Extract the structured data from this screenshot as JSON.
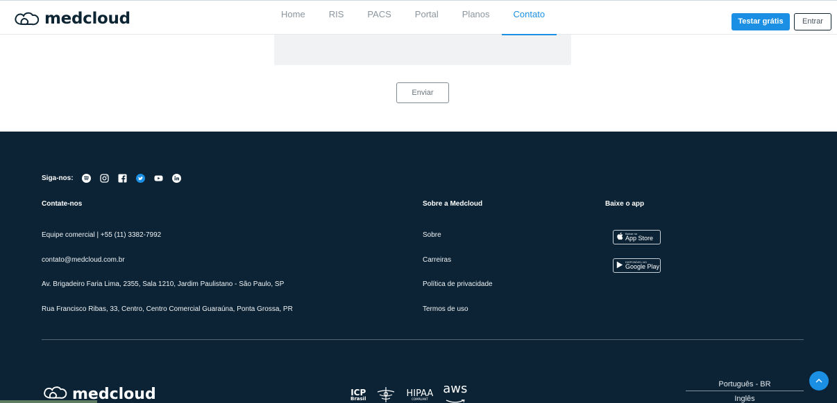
{
  "header": {
    "brand": "medcloud",
    "nav": [
      {
        "label": "Home",
        "active": false
      },
      {
        "label": "RIS",
        "active": false
      },
      {
        "label": "PACS",
        "active": false
      },
      {
        "label": "Portal",
        "active": false
      },
      {
        "label": "Planos",
        "active": false
      },
      {
        "label": "Contato",
        "active": true
      }
    ],
    "trial_label": "Testar grátis",
    "login_label": "Entrar"
  },
  "form": {
    "send_label": "Enviar"
  },
  "footer": {
    "follow_label": "Siga-nos:",
    "social_icons": [
      "spotify-icon",
      "instagram-icon",
      "facebook-icon",
      "twitter-icon",
      "youtube-icon",
      "linkedin-icon"
    ],
    "contact": {
      "heading": "Contate-nos",
      "items": [
        "Equipe comercial | +55 (11) 3382-7992",
        "contato@medcloud.com.br",
        "Av. Brigadeiro Faria Lima, 2355, Sala 1210, Jardim Paulistano - São Paulo, SP",
        "Rua Francisco Ribas, 33, Centro, Centro Comercial Guaraúna, Ponta Grossa, PR"
      ]
    },
    "about": {
      "heading": "Sobre a Medcloud",
      "items": [
        "Sobre",
        "Carreiras",
        "Política de privacidade",
        "Termos de uso"
      ]
    },
    "app": {
      "heading": "Baixe o app",
      "app_store_small": "Baixar na",
      "app_store_big": "App Store",
      "google_play_small": "DISPONÍVEL NO",
      "google_play_big": "Google Play"
    },
    "brand": "medcloud",
    "certs": {
      "icp_line1": "ICP",
      "icp_line2": "Brasil",
      "hipaa": "HIPAA",
      "hipaa_sub": "COMPLIANT",
      "aws": "aws"
    },
    "languages": [
      "Português - BR",
      "Inglês"
    ]
  },
  "colors": {
    "accent": "#1a8fe3",
    "footer_bg": "#0b2335",
    "brand_dark": "#0d2433"
  }
}
